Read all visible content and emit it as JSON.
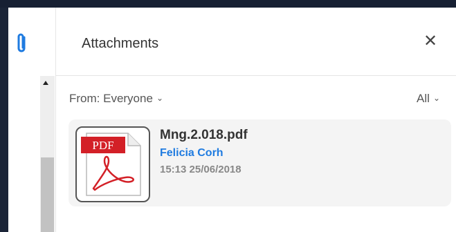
{
  "icons": {
    "paperclip": "paperclip-icon",
    "close": "close-icon",
    "chevron": "chevron-down-icon",
    "file": "pdf-file-icon"
  },
  "colors": {
    "accent": "#1f7be0",
    "pdf_red": "#d32027"
  },
  "panel": {
    "title": "Attachments",
    "close_glyph": "✕"
  },
  "filters": {
    "from_label": "From: Everyone",
    "type_label": "All",
    "chevron": "⌄"
  },
  "attachments": [
    {
      "file_name": "Mng.2.018.pdf",
      "sender": "Felicia Corh",
      "timestamp": "15:13 25/06/2018",
      "file_type_label": "PDF"
    }
  ]
}
